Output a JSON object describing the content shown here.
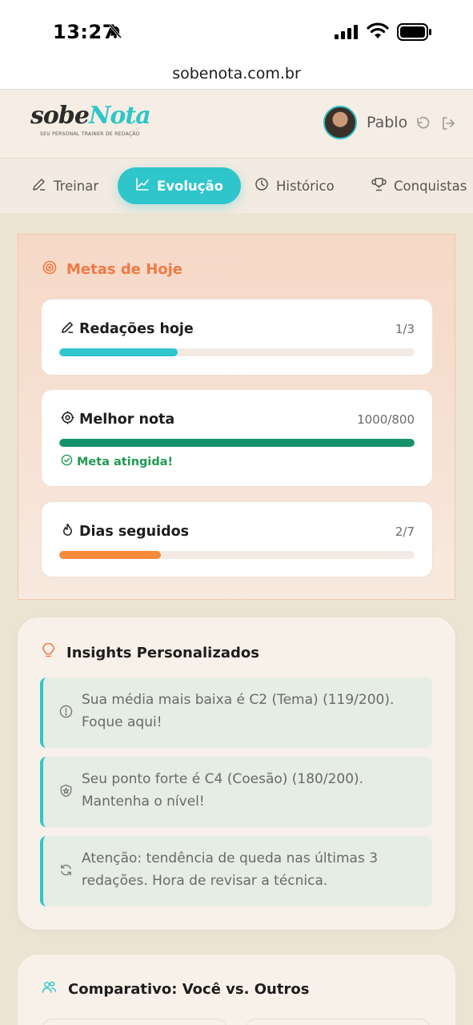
{
  "status": {
    "time": "13:27"
  },
  "browser": {
    "url": "sobenota.com.br"
  },
  "header": {
    "logo_part1": "sobe",
    "logo_part2": "Nota",
    "logo_tagline": "SEU PERSONAL TRAINER DE REDAÇÃO",
    "username": "Pablo"
  },
  "tabs": [
    {
      "label": "Treinar",
      "icon": "pencil-icon"
    },
    {
      "label": "Evolução",
      "icon": "trend-icon",
      "active": true
    },
    {
      "label": "Histórico",
      "icon": "clock-icon"
    },
    {
      "label": "Conquistas",
      "icon": "trophy-icon"
    }
  ],
  "metas": {
    "title": "Metas de Hoje",
    "goals": [
      {
        "label": "Redações hoje",
        "value": "1/3",
        "progress": 0.333,
        "color": "#2ec5cf",
        "icon": "pencil-icon"
      },
      {
        "label": "Melhor nota",
        "value": "1000/800",
        "progress": 1.0,
        "color": "#14936b",
        "icon": "target-icon",
        "status": "Meta atingida!"
      },
      {
        "label": "Dias seguidos",
        "value": "2/7",
        "progress": 0.286,
        "color": "#f58b3a",
        "icon": "flame-icon"
      }
    ]
  },
  "insights": {
    "title": "Insights Personalizados",
    "items": [
      {
        "text": "Sua média mais baixa é C2 (Tema) (119/200). Foque aqui!",
        "icon": "alert-circle-icon"
      },
      {
        "text": "Seu ponto forte é C4 (Coesão) (180/200). Mantenha o nível!",
        "icon": "shield-star-icon"
      },
      {
        "text": "Atenção: tendência de queda nas últimas 3 redações. Hora de revisar a técnica.",
        "icon": "refresh-icon"
      }
    ]
  },
  "comparativo": {
    "title": "Comparativo: Você vs. Outros"
  },
  "colors": {
    "accent": "#2ec5c9",
    "orange": "#ef7a45",
    "success": "#1f9a52"
  }
}
